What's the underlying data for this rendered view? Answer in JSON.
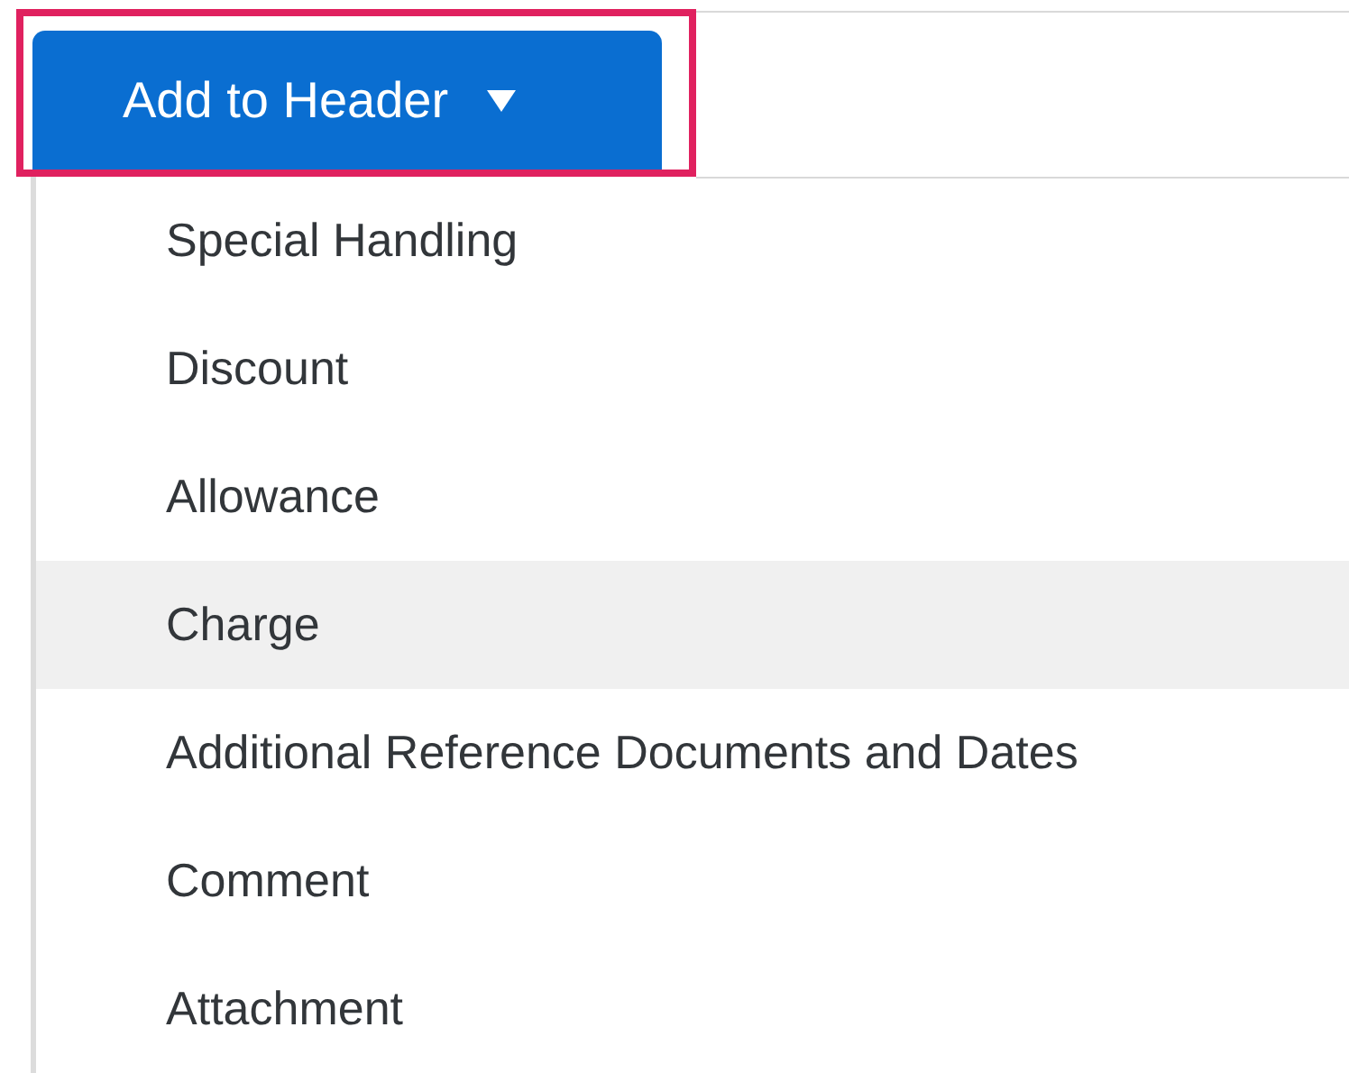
{
  "button": {
    "label": "Add to Header",
    "highlighted": true
  },
  "menu": {
    "items": [
      {
        "label": "Special Handling",
        "highlighted": false
      },
      {
        "label": "Discount",
        "highlighted": false
      },
      {
        "label": "Allowance",
        "highlighted": false
      },
      {
        "label": "Charge",
        "highlighted": true
      },
      {
        "label": "Additional Reference Documents and Dates",
        "highlighted": false
      },
      {
        "label": "Comment",
        "highlighted": false
      },
      {
        "label": "Attachment",
        "highlighted": false
      }
    ]
  }
}
